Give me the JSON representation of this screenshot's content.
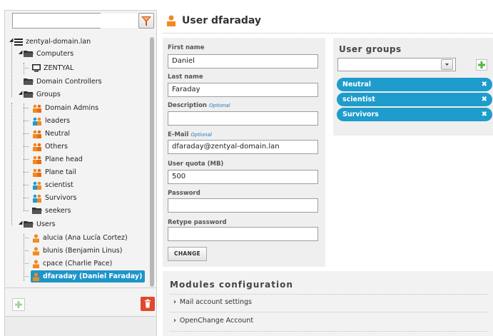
{
  "search": {
    "value": ""
  },
  "header": {
    "title": "User dfaraday"
  },
  "tree": {
    "root": "zentyal-domain.lan",
    "computers": "Computers",
    "computer_items": [
      "ZENTYAL"
    ],
    "domain_controllers": "Domain Controllers",
    "groups": "Groups",
    "group_items": [
      "Domain Admins",
      "leaders",
      "Neutral",
      "Others",
      "Plane head",
      "Plane tail",
      "scientist",
      "Survivors",
      "seekers"
    ],
    "users": "Users",
    "user_items": [
      "alucia (Ana Lucía Cortez)",
      "blunis (Benjamin Linus)",
      "cpace (Charlie Pace)",
      "dfaraday (Daniel Faraday)"
    ]
  },
  "form": {
    "first_name_label": "First name",
    "first_name": "Daniel",
    "last_name_label": "Last name",
    "last_name": "Faraday",
    "description_label": "Description",
    "description_optional": "Optional",
    "description": "",
    "email_label": "E-Mail",
    "email_optional": "Optional",
    "email": "dfaraday@zentyal-domain.lan",
    "quota_label": "User quota (MB)",
    "quota": "500",
    "password_label": "Password",
    "password": "",
    "retype_label": "Retype password",
    "retype": "",
    "change_button": "CHANGE"
  },
  "user_groups": {
    "title": "User groups",
    "selected": "",
    "chips": [
      "Neutral",
      "scientist",
      "Survivors"
    ]
  },
  "modules": {
    "title": "Modules configuration",
    "items": [
      "Mail account settings",
      "OpenChange Account"
    ]
  },
  "colors": {
    "accent": "#1e9ccb",
    "user_icon": "#f28a1e",
    "danger": "#e0492b",
    "add_green": "#59b54a"
  }
}
